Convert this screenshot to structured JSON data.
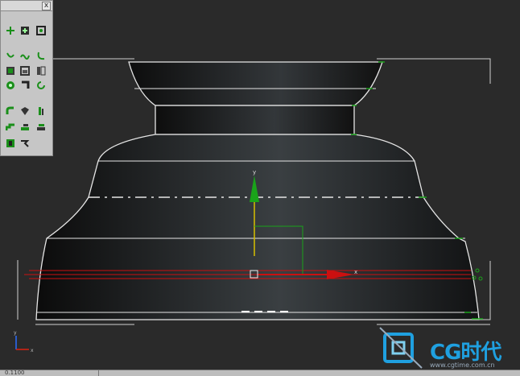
{
  "viewport": {
    "background": "#2a2a2a",
    "gizmo": {
      "y_label": "y",
      "x_label": "x"
    },
    "axis_tripod": {
      "y_label": "y",
      "x_label": "x"
    }
  },
  "toolbar": {
    "close_label": "x",
    "buttons": [
      "move-icon",
      "grid-add-icon",
      "snap-icon",
      "curve-s-icon",
      "curve-wave-icon",
      "curve-hook-icon",
      "box-icon",
      "box-frame-icon",
      "book-icon",
      "gear-green-icon",
      "bolt-icon",
      "rotate-arrow-icon",
      "shape-l-icon",
      "cube-cut-icon",
      "bar-icon",
      "stairs-icon",
      "stack-icon",
      "stack-alt-icon",
      "frame-icon",
      "arrow-flag-icon"
    ]
  },
  "statusbar": {
    "field_value": "0.1100"
  },
  "watermark": {
    "brand": "CG时代",
    "url": "www.cgtime.com.cn"
  },
  "colors": {
    "accent_green": "#1aa31a",
    "axis_red": "#cc1010",
    "axis_yellow": "#d6c000",
    "outline_white": "#e6e6e6",
    "brand_blue": "#1fa0e0"
  }
}
